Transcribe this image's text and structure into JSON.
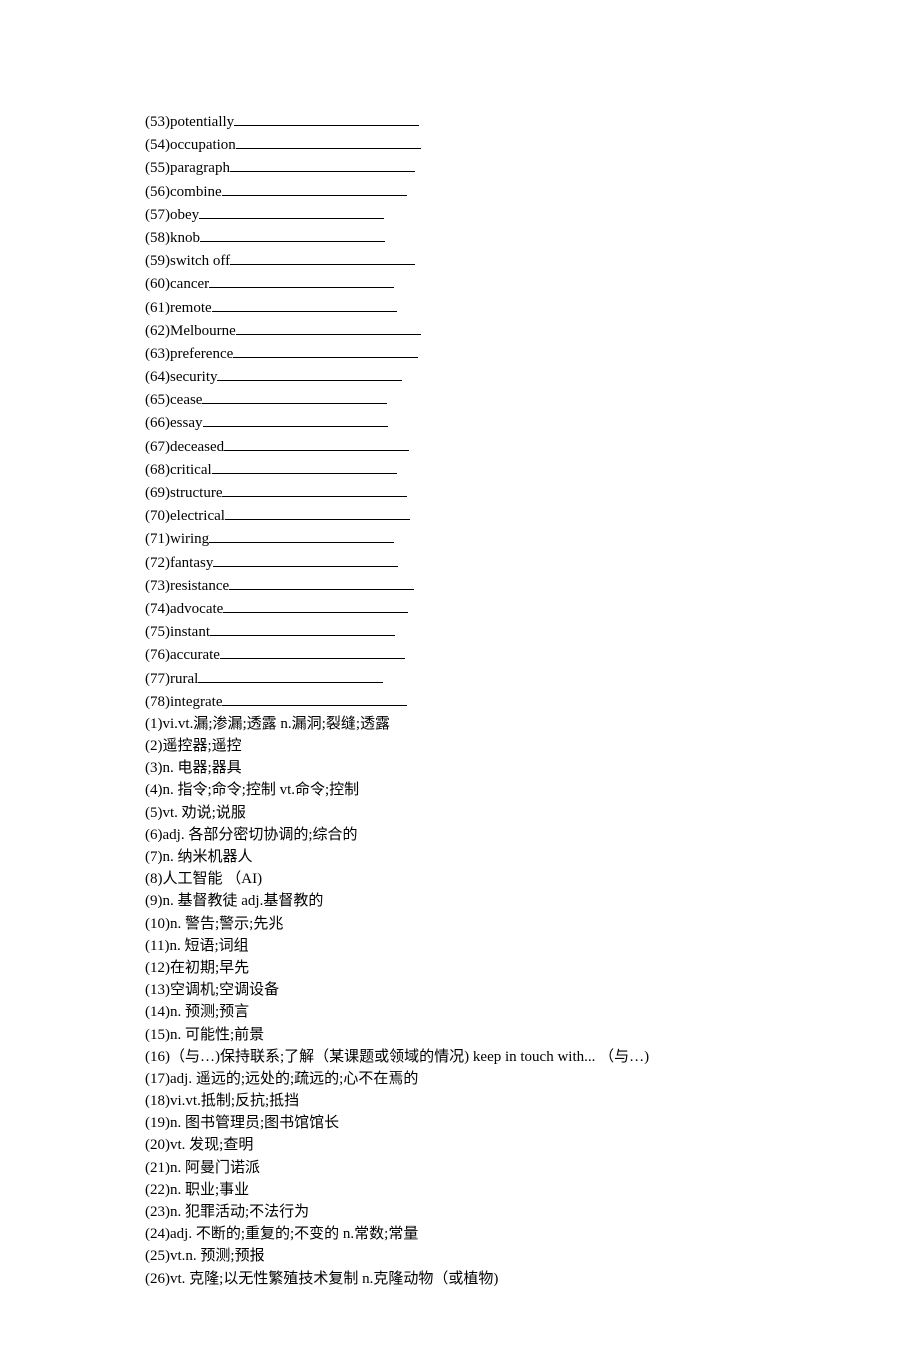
{
  "vocab": [
    {
      "n": "(53)",
      "w": "potentially"
    },
    {
      "n": "(54)",
      "w": "occupation"
    },
    {
      "n": "(55)",
      "w": "paragraph"
    },
    {
      "n": "(56)",
      "w": "combine"
    },
    {
      "n": "(57)",
      "w": "obey"
    },
    {
      "n": "(58)",
      "w": "knob"
    },
    {
      "n": "(59)",
      "w": "switch off"
    },
    {
      "n": "(60)",
      "w": "cancer"
    },
    {
      "n": "(61)",
      "w": "remote"
    },
    {
      "n": "(62)",
      "w": "Melbourne"
    },
    {
      "n": "(63)",
      "w": "preference"
    },
    {
      "n": "(64)",
      "w": "security"
    },
    {
      "n": "(65)",
      "w": "cease"
    },
    {
      "n": "(66)",
      "w": "essay"
    },
    {
      "n": "(67)",
      "w": "deceased"
    },
    {
      "n": "(68)",
      "w": "critical"
    },
    {
      "n": "(69)",
      "w": "structure"
    },
    {
      "n": "(70)",
      "w": "electrical"
    },
    {
      "n": "(71)",
      "w": "wiring"
    },
    {
      "n": "(72)",
      "w": "fantasy"
    },
    {
      "n": "(73)",
      "w": "resistance"
    },
    {
      "n": "(74)",
      "w": "advocate"
    },
    {
      "n": "(75)",
      "w": "instant"
    },
    {
      "n": "(76)",
      "w": "accurate"
    },
    {
      "n": "(77)",
      "w": "rural"
    },
    {
      "n": "(78)",
      "w": "integrate"
    }
  ],
  "defs": [
    {
      "n": "(1)",
      "t": "vi.vt.漏;渗漏;透露  n.漏洞;裂缝;透露"
    },
    {
      "n": "(2)",
      "t": "遥控器;遥控"
    },
    {
      "n": "(3)",
      "t": "n.  电器;器具"
    },
    {
      "n": "(4)",
      "t": "n.  指令;命令;控制  vt.命令;控制"
    },
    {
      "n": "(5)",
      "t": "vt.  劝说;说服"
    },
    {
      "n": "(6)",
      "t": "adj.  各部分密切协调的;综合的"
    },
    {
      "n": "(7)",
      "t": "n.  纳米机器人"
    },
    {
      "n": "(8)",
      "t": "人工智能  （AI)"
    },
    {
      "n": "(9)",
      "t": "n.  基督教徒  adj.基督教的"
    },
    {
      "n": "(10)",
      "t": "n.  警告;警示;先兆"
    },
    {
      "n": "(11)",
      "t": "n.  短语;词组"
    },
    {
      "n": "(12)",
      "t": "在初期;早先"
    },
    {
      "n": "(13)",
      "t": "空调机;空调设备"
    },
    {
      "n": "(14)",
      "t": "n.  预测;预言"
    },
    {
      "n": "(15)",
      "t": "n.  可能性;前景"
    },
    {
      "n": "(16)",
      "t": "（与…)保持联系;了解（某课题或领域的情况) keep in touch with...  （与…)"
    },
    {
      "n": "(17)",
      "t": "adj.  遥远的;远处的;疏远的;心不在焉的"
    },
    {
      "n": "(18)",
      "t": "vi.vt.抵制;反抗;抵挡"
    },
    {
      "n": "(19)",
      "t": "n.  图书管理员;图书馆馆长"
    },
    {
      "n": "(20)",
      "t": "vt.  发现;查明"
    },
    {
      "n": "(21)",
      "t": "n.  阿曼门诺派"
    },
    {
      "n": "(22)",
      "t": "n.  职业;事业"
    },
    {
      "n": "(23)",
      "t": "n.  犯罪活动;不法行为"
    },
    {
      "n": "(24)",
      "t": "adj.  不断的;重复的;不变的  n.常数;常量"
    },
    {
      "n": "(25)",
      "t": "vt.n.  预测;预报"
    },
    {
      "n": "(26)",
      "t": "vt.  克隆;以无性繁殖技术复制  n.克隆动物（或植物)"
    }
  ]
}
